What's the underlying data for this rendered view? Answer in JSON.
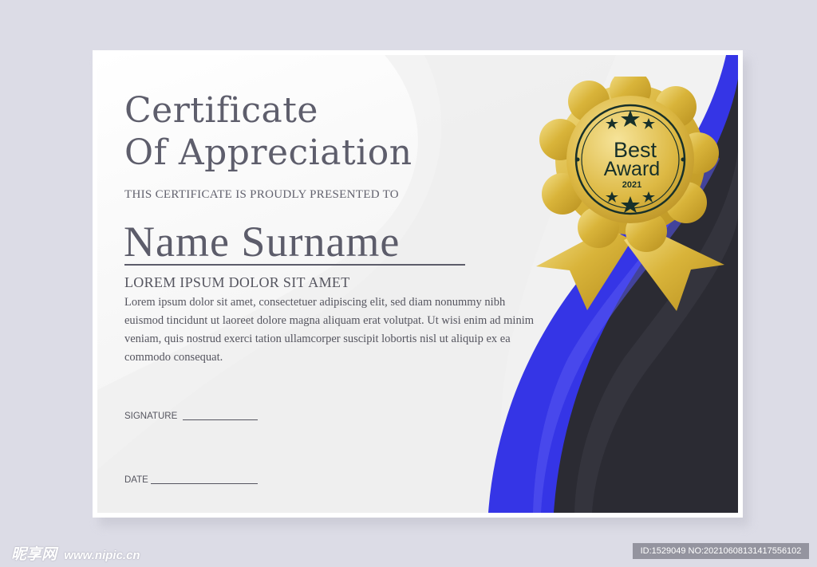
{
  "certificate": {
    "title_line1": "Certificate",
    "title_line2": "Of Appreciation",
    "presented_to": "THIS CERTIFICATE IS PROUDLY PRESENTED TO",
    "recipient_name": "Name Surname",
    "subheading": "LOREM IPSUM DOLOR SIT AMET",
    "body": "Lorem ipsum dolor sit amet, consectetuer adipiscing elit, sed diam nonummy nibh euismod tincidunt ut laoreet dolore magna aliquam erat volutpat. Ut wisi enim ad minim veniam, quis nostrud exerci tation ullamcorper suscipit lobortis nisl ut aliquip ex ea commodo consequat.",
    "signature_label": "SIGNATURE",
    "date_label": "DATE"
  },
  "seal": {
    "line1": "Best",
    "line2": "Award",
    "year": "2021",
    "star_count": 6,
    "icon": "award-seal-icon"
  },
  "watermark": {
    "site_name": "昵享网",
    "url": "www.nipic.cn",
    "id_text": "ID:1529049 NO:20210608131417556102"
  },
  "colors": {
    "accent_blue": "#3535e6",
    "dark_band": "#2b2b33",
    "gold": "#d9b43a",
    "title_gray": "#5e5e6c"
  }
}
